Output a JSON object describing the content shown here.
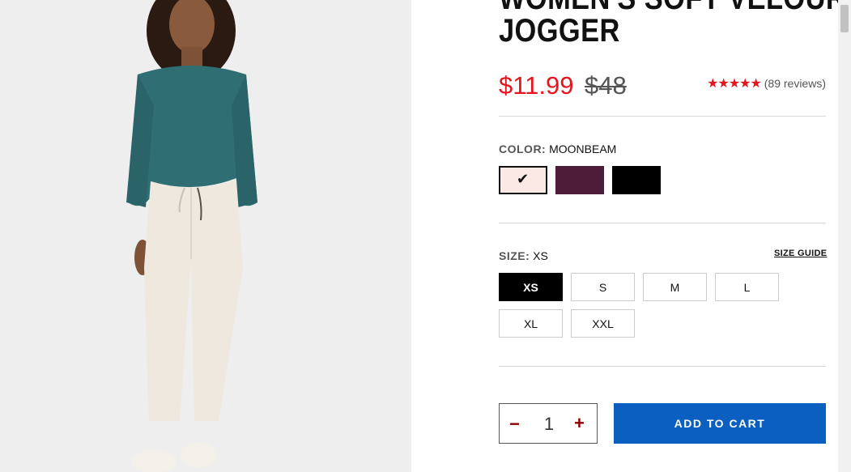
{
  "product": {
    "title_line1": "WOMEN'S SOFT VELOUR",
    "title_line2": "JOGGER",
    "price_sale": "$11.99",
    "price_original": "$48",
    "stars": "★★★★★",
    "reviews": "(89 reviews)",
    "rating_value": 5
  },
  "color": {
    "label": "COLOR:",
    "selected": "MOONBEAM",
    "swatches": [
      {
        "name": "moonbeam",
        "hex": "#fbe9e5",
        "selected": true
      },
      {
        "name": "plum",
        "hex": "#4d1c38",
        "selected": false
      },
      {
        "name": "black",
        "hex": "#000000",
        "selected": false
      }
    ],
    "check_glyph": "✔"
  },
  "size": {
    "label": "SIZE:",
    "selected": "XS",
    "guide": "SIZE GUIDE",
    "options": [
      "XS",
      "S",
      "M",
      "L",
      "XL",
      "XXL"
    ]
  },
  "cart": {
    "minus": "−",
    "quantity": "1",
    "plus": "+",
    "add_label": "ADD TO CART"
  },
  "colors": {
    "sale": "#e4151c",
    "accent_blue": "#0a5fc0",
    "qty_icon": "#8b0000"
  }
}
